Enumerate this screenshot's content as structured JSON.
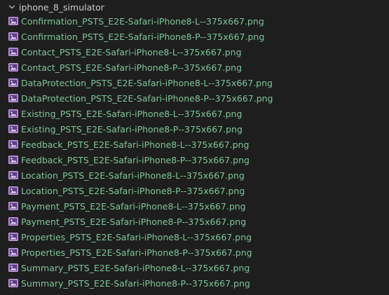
{
  "explorer": {
    "folder": {
      "name": "iphone_8_simulator",
      "expanded": true
    },
    "file_icon": "image-file-icon",
    "file_label_color": "#7ec699",
    "files": [
      "Confirmation_PSTS_E2E-Safari-iPhone8-L--375x667.png",
      "Confirmation_PSTS_E2E-Safari-iPhone8-P--375x667.png",
      "Contact_PSTS_E2E-Safari-iPhone8-L--375x667.png",
      "Contact_PSTS_E2E-Safari-iPhone8-P--375x667.png",
      "DataProtection_PSTS_E2E-Safari-iPhone8-L--375x667.png",
      "DataProtection_PSTS_E2E-Safari-iPhone8-P--375x667.png",
      "Existing_PSTS_E2E-Safari-iPhone8-L--375x667.png",
      "Existing_PSTS_E2E-Safari-iPhone8-P--375x667.png",
      "Feedback_PSTS_E2E-Safari-iPhone8-L--375x667.png",
      "Feedback_PSTS_E2E-Safari-iPhone8-P--375x667.png",
      "Location_PSTS_E2E-Safari-iPhone8-L--375x667.png",
      "Location_PSTS_E2E-Safari-iPhone8-P--375x667.png",
      "Payment_PSTS_E2E-Safari-iPhone8-L--375x667.png",
      "Payment_PSTS_E2E-Safari-iPhone8-P--375x667.png",
      "Properties_PSTS_E2E-Safari-iPhone8-L--375x667.png",
      "Properties_PSTS_E2E-Safari-iPhone8-P--375x667.png",
      "Summary_PSTS_E2E-Safari-iPhone8-L--375x667.png",
      "Summary_PSTS_E2E-Safari-iPhone8-P--375x667.png"
    ]
  }
}
